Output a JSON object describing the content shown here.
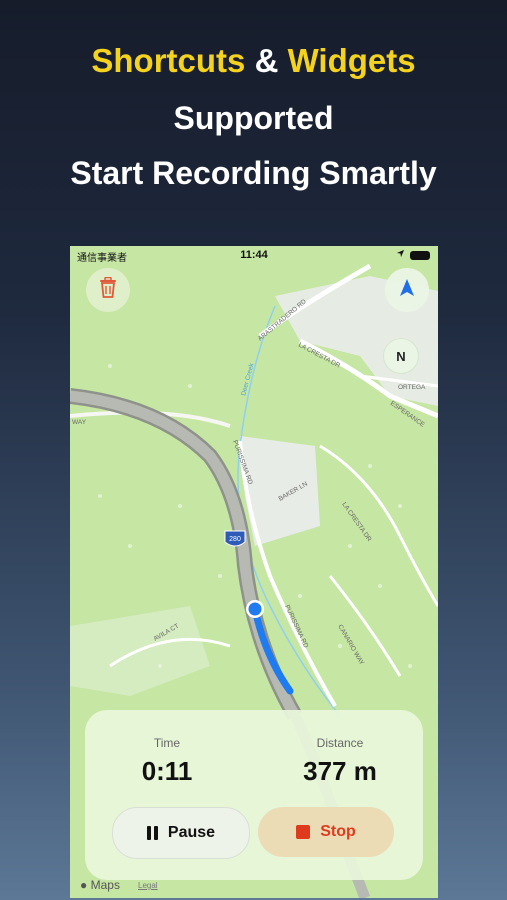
{
  "headline": {
    "line1_part1": "Shortcuts",
    "line1_amp": "&",
    "line1_part2": "Widgets",
    "line2": "Supported",
    "line3": "Start Recording Smartly"
  },
  "status_bar": {
    "carrier": "通信事業者",
    "time": "11:44"
  },
  "map": {
    "compass_label": "N",
    "shield_label": "280",
    "road_labels": [
      "ARASTRADERO RD",
      "LA CRESTA DR",
      "ORTEGA",
      "ESPERANCE",
      "PURISSIMA RD",
      "BAKER LN",
      "LA CRESTA DR",
      "PURISSIMA RD",
      "CANARIO WAY",
      "AVILA CT",
      "Deer Creek",
      "WAY"
    ]
  },
  "recording": {
    "time_label": "Time",
    "time_value": "0:11",
    "distance_label": "Distance",
    "distance_value": "377 m",
    "pause_label": "Pause",
    "stop_label": "Stop"
  },
  "footer": {
    "maps_label": "Maps",
    "legal_label": "Legal"
  },
  "colors": {
    "accent_yellow": "#f5d31c",
    "route_blue": "#1e7bf0",
    "stop_red": "#e03a1e"
  }
}
